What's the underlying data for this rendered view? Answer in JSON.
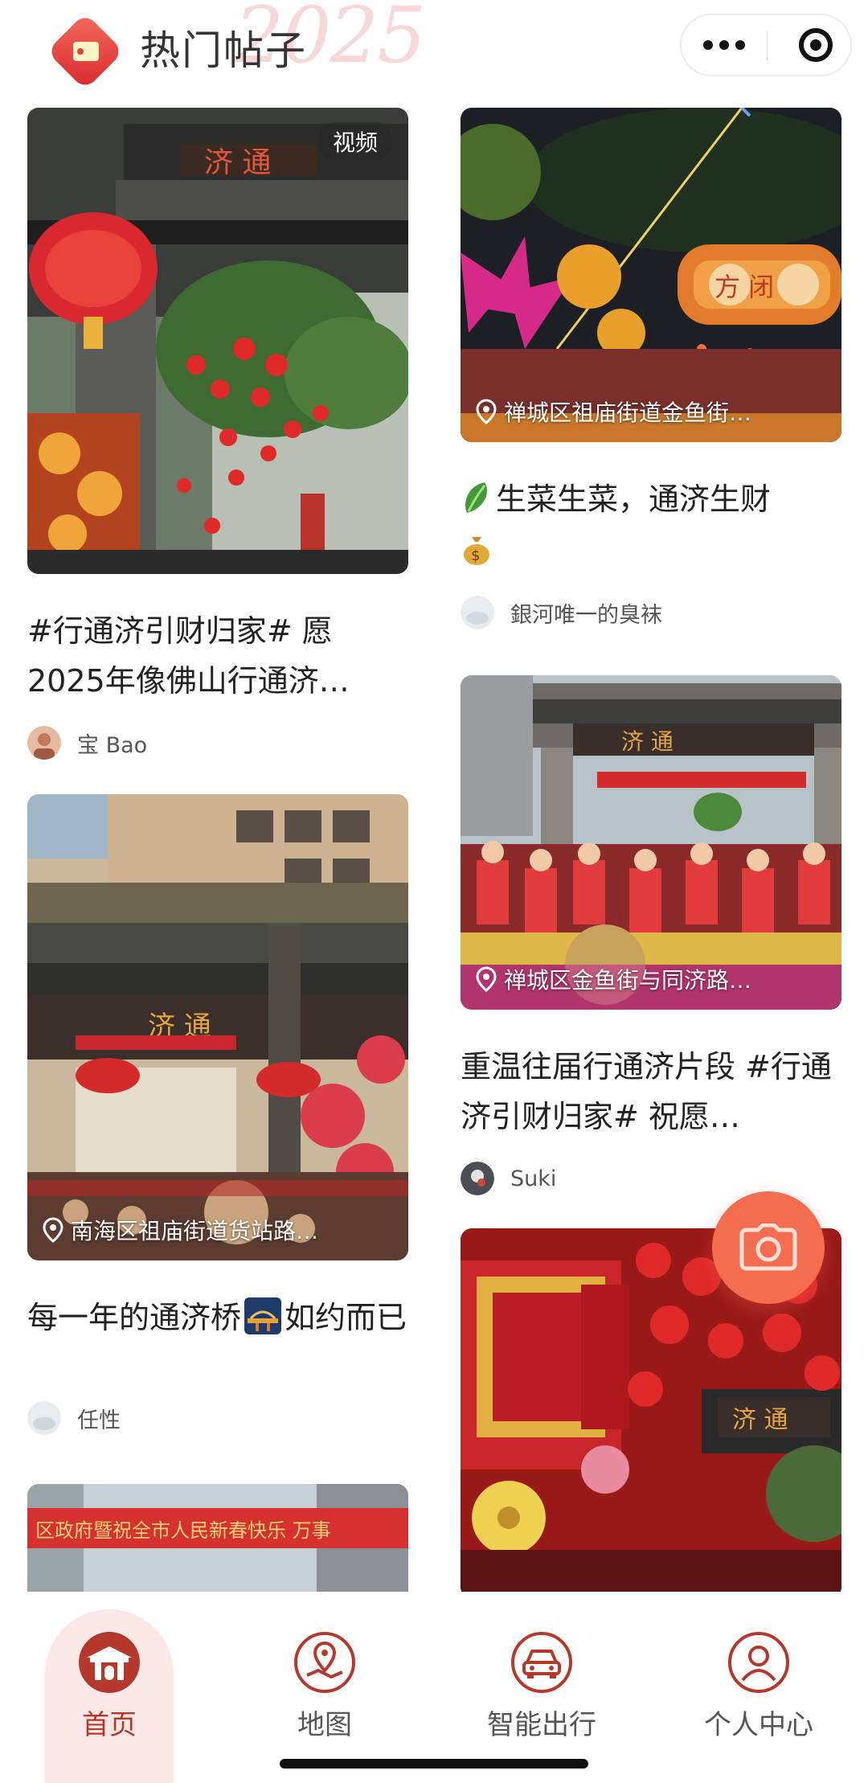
{
  "header": {
    "title": "热门帖子",
    "decoration_text": "2025"
  },
  "feed": {
    "left": [
      {
        "badge": "视频",
        "title": "#行通济引财归家# 愿2025年像佛山行通济…",
        "author": "宝 Bao"
      },
      {
        "location": "南海区祖庙街道货站路…",
        "title_before": "每一年的通济桥",
        "title_after": "如约而已",
        "author": "任性"
      },
      {
        "banner_text": "区政府暨祝全市人民新春快乐 万事"
      }
    ],
    "right": [
      {
        "location": "禅城区祖庙街道金鱼街…",
        "title": "生菜生菜，通济生财",
        "author": "銀河唯一的臭袜"
      },
      {
        "location": "禅城区金鱼街与同济路…",
        "title": "重温往届行通济片段 #行通济引财归家# 祝愿…",
        "author": "Suki"
      },
      {
        "sign_text": "济 通"
      }
    ],
    "gate_text_1": "济 通",
    "gate_text_2": "方 闭",
    "gate_text_3": "济 通",
    "gate_text_4": "济 通"
  },
  "fab": {
    "icon": "camera-icon"
  },
  "tabbar": {
    "items": [
      {
        "label": "首页",
        "icon": "home-gate-icon",
        "active": true
      },
      {
        "label": "地图",
        "icon": "map-pin-icon",
        "active": false
      },
      {
        "label": "智能出行",
        "icon": "car-icon",
        "active": false
      },
      {
        "label": "个人中心",
        "icon": "user-icon",
        "active": false
      }
    ]
  },
  "colors": {
    "accent": "#b5382c",
    "fab": "#f36d4e",
    "active_tab_bg": "#fbe8e6"
  }
}
